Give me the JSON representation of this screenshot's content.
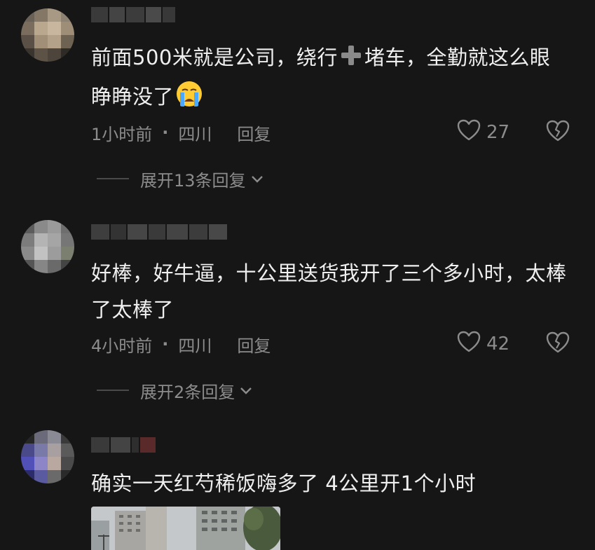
{
  "comments": [
    {
      "text_part1": "前面500米就是公司，绕行",
      "text_part2": "堵车，全勤就这么眼睁睁没了",
      "emoji": "loudly-crying-face",
      "time": "1小时前",
      "separator": "·",
      "location": "四川",
      "reply_label": "回复",
      "likes": "27",
      "expand_label": "展开13条回复"
    },
    {
      "text": "好棒，好牛逼，十公里送货我开了三个多小时，太棒了太棒了",
      "time": "4小时前",
      "separator": "·",
      "location": "四川",
      "reply_label": "回复",
      "likes": "42",
      "expand_label": "展开2条回复"
    },
    {
      "text": "确实一天红芍稀饭嗨多了 4公里开1个小时",
      "has_image": true
    }
  ],
  "colors": {
    "background": "#161616",
    "text_primary": "#efefef",
    "text_secondary": "#8c8c8c"
  },
  "icons": {
    "like": "heart-outline-icon",
    "dislike": "broken-heart-icon",
    "expand": "chevron-down-icon",
    "plus": "heavy-plus-sign-emoji"
  }
}
